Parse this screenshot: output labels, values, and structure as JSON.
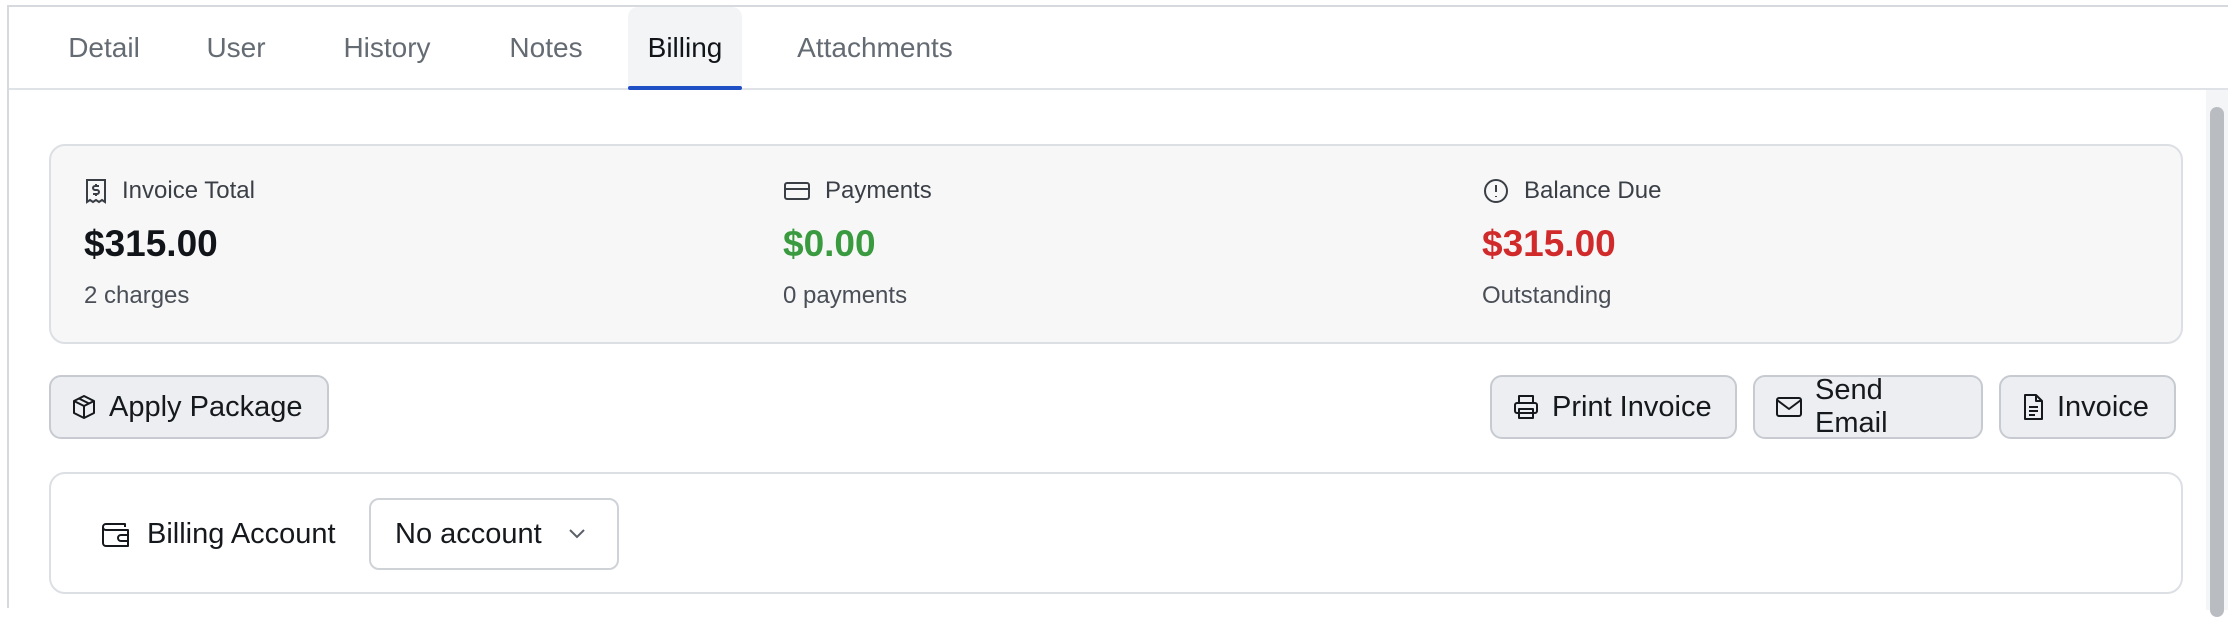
{
  "tabs": [
    {
      "label": "Detail",
      "active": false
    },
    {
      "label": "User",
      "active": false
    },
    {
      "label": "History",
      "active": false
    },
    {
      "label": "Notes",
      "active": false
    },
    {
      "label": "Billing",
      "active": true
    },
    {
      "label": "Attachments",
      "active": false
    }
  ],
  "summary": {
    "invoice_total": {
      "label": "Invoice Total",
      "value": "$315.00",
      "sub": "2 charges",
      "icon": "receipt-dollar-icon"
    },
    "payments": {
      "label": "Payments",
      "value": "$0.00",
      "sub": "0 payments",
      "icon": "credit-card-icon"
    },
    "balance_due": {
      "label": "Balance Due",
      "value": "$315.00",
      "sub": "Outstanding",
      "icon": "alert-circle-icon"
    }
  },
  "actions": {
    "apply_package": "Apply Package",
    "print_invoice": "Print Invoice",
    "send_email": "Send Email",
    "invoice": "Invoice"
  },
  "billing_account": {
    "label": "Billing Account",
    "selected": "No account"
  },
  "colors": {
    "accent": "#1f4fc5",
    "payments_green": "#3a9a3f",
    "balance_red": "#d12a2a"
  }
}
